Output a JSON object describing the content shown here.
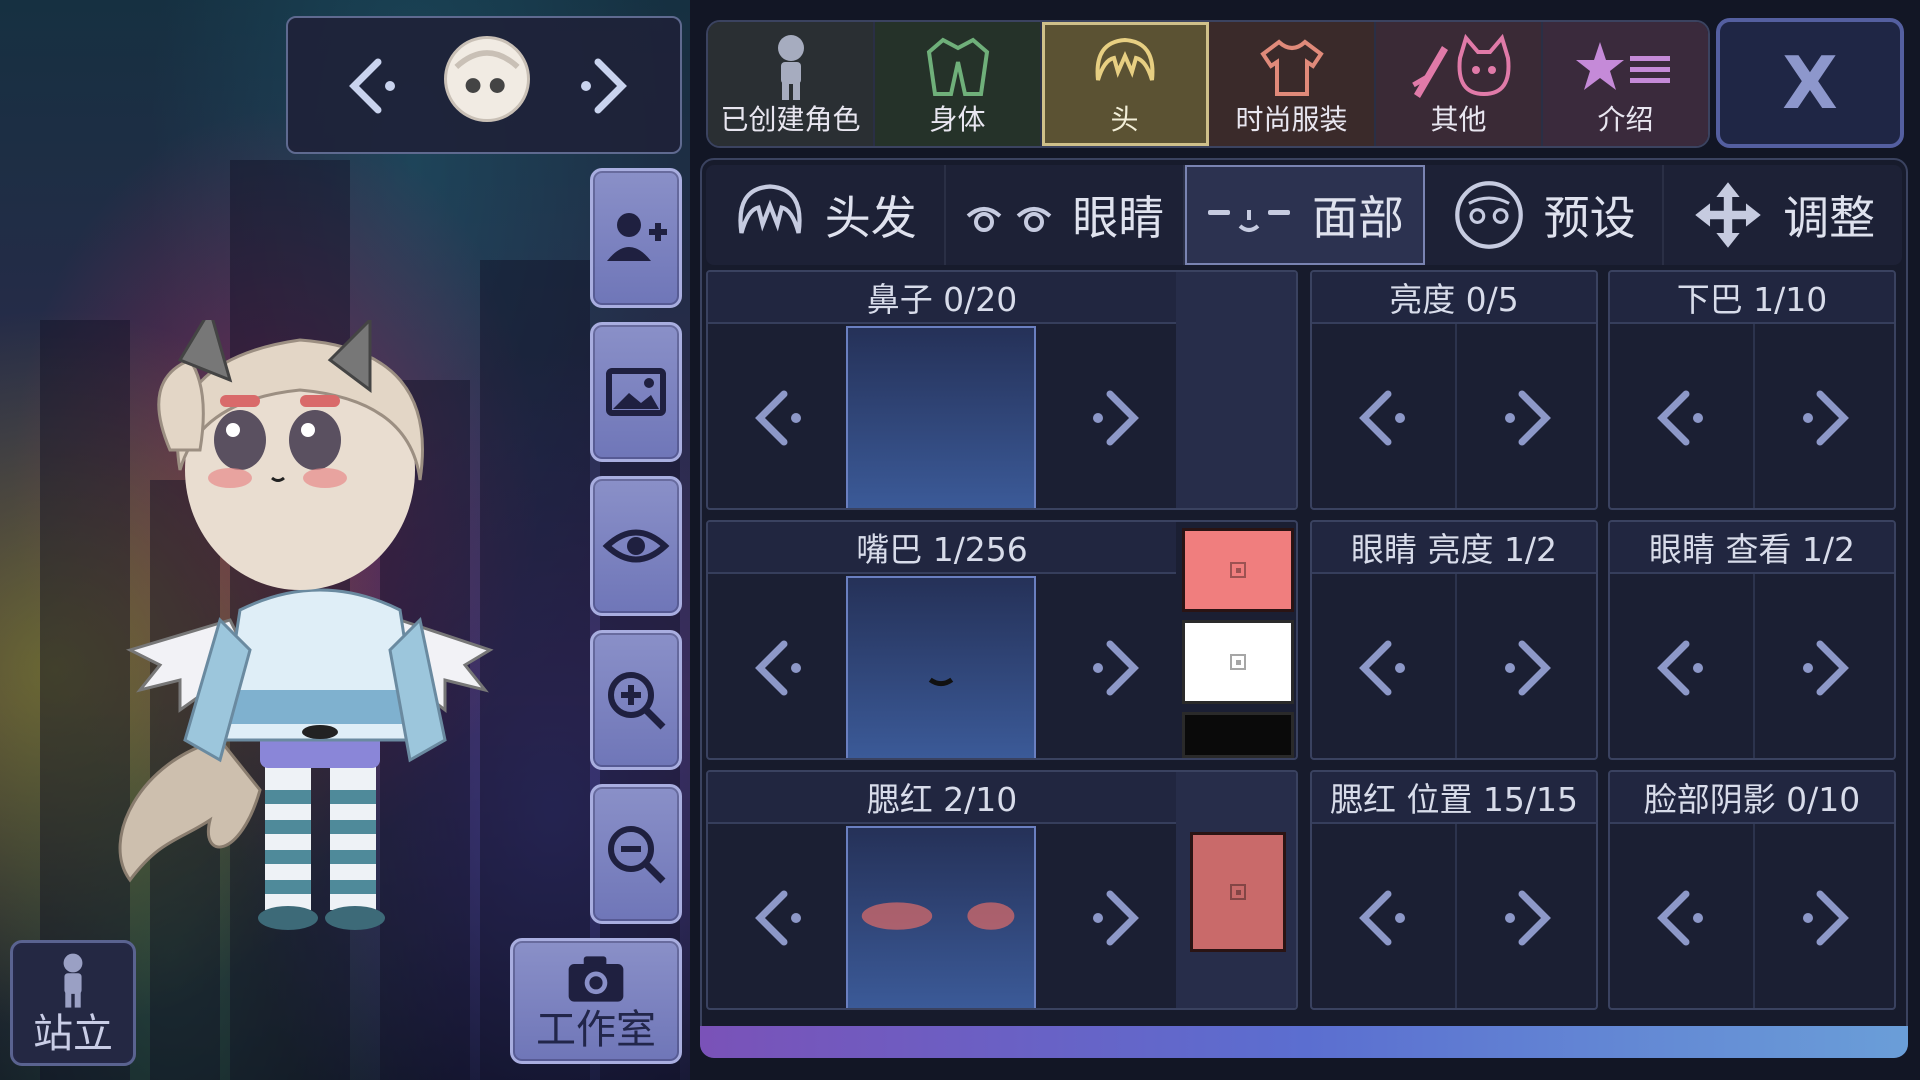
{
  "top_tabs": [
    {
      "id": "created",
      "label": "已创建角色",
      "bg": "#2a2f33"
    },
    {
      "id": "body",
      "label": "身体",
      "bg": "#253229"
    },
    {
      "id": "head",
      "label": "头",
      "bg": "#5b5233",
      "active": true
    },
    {
      "id": "fashion",
      "label": "时尚服装",
      "bg": "#3a2a2a"
    },
    {
      "id": "other",
      "label": "其他",
      "bg": "#3a2a36"
    },
    {
      "id": "intro",
      "label": "介绍",
      "bg": "#3a2a3c"
    }
  ],
  "close_label": "X",
  "sub_tabs": [
    {
      "label": "头发"
    },
    {
      "label": "眼睛"
    },
    {
      "label": "面部",
      "active": true
    },
    {
      "label": "预设"
    },
    {
      "label": "调整"
    }
  ],
  "options": {
    "nose": {
      "label": "鼻子 0/20",
      "current": 0,
      "total": 20
    },
    "brightness": {
      "label": "亮度 0/5",
      "current": 0,
      "total": 5
    },
    "chin": {
      "label": "下巴 1/10",
      "current": 1,
      "total": 10
    },
    "mouth": {
      "label": "嘴巴 1/256",
      "current": 1,
      "total": 256
    },
    "eye_brightness": {
      "label": "眼睛 亮度 1/2",
      "current": 1,
      "total": 2
    },
    "eye_look": {
      "label": "眼睛 查看 1/2",
      "current": 1,
      "total": 2
    },
    "blush": {
      "label": "腮红 2/10",
      "current": 2,
      "total": 10
    },
    "blush_position": {
      "label": "腮红 位置 15/15",
      "current": 15,
      "total": 15
    },
    "face_shadow": {
      "label": "脸部阴影 0/10",
      "current": 0,
      "total": 10
    }
  },
  "colors": {
    "mouth_swatch_1": "#f07e7e",
    "mouth_swatch_2": "#ffffff",
    "mouth_swatch_3": "#0a0a0a",
    "blush_swatch": "#c96a6a",
    "active_tab": "#cfc08a",
    "accent": "#8a90c8"
  },
  "left": {
    "studio_label": "工作室",
    "pose_label": "站立"
  }
}
